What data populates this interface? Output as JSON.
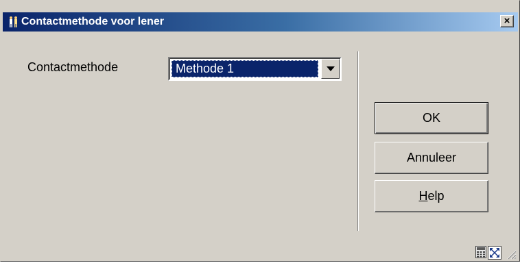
{
  "window": {
    "title": "Contactmethode voor lener",
    "title_icon": "borrower-figures-icon",
    "close_label": "×"
  },
  "form": {
    "contact_method_label": "Contactmethode",
    "contact_method_value": "Methode 1"
  },
  "buttons": {
    "ok_label": "OK",
    "cancel_label": "Annuleer",
    "help_label": "Help"
  },
  "status_bar": {
    "icons": [
      "calculator-icon",
      "resize-icon",
      "size-grip-icon"
    ]
  },
  "colors": {
    "title_gradient_start": "#0a246a",
    "title_gradient_end": "#a6caf0",
    "dialog_background": "#d4d0c8",
    "selection_background": "#0a246a"
  }
}
